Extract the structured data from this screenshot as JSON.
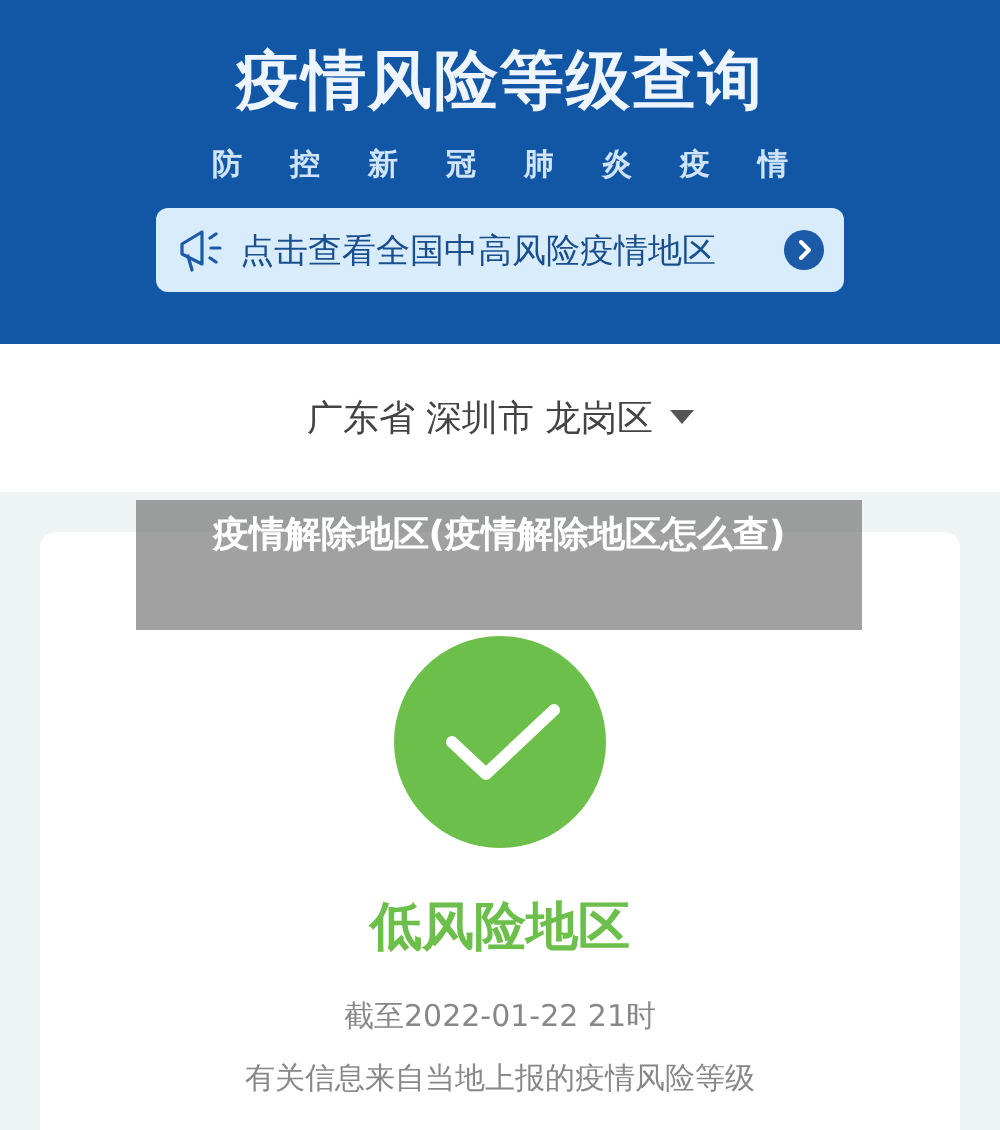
{
  "header": {
    "title": "疫情风险等级查询",
    "subtitle": "防控新冠肺炎疫情"
  },
  "notice": {
    "text": "点击查看全国中高风险疫情地区"
  },
  "location": {
    "value": "广东省 深圳市 龙岗区"
  },
  "result": {
    "kind": "low",
    "label": "低风险地区",
    "as_of": "截至2022-01-22 21时",
    "note": "有关信息来自当地上报的疫情风险等级"
  },
  "caption": {
    "text": "疫情解除地区(疫情解除地区怎么查)"
  }
}
